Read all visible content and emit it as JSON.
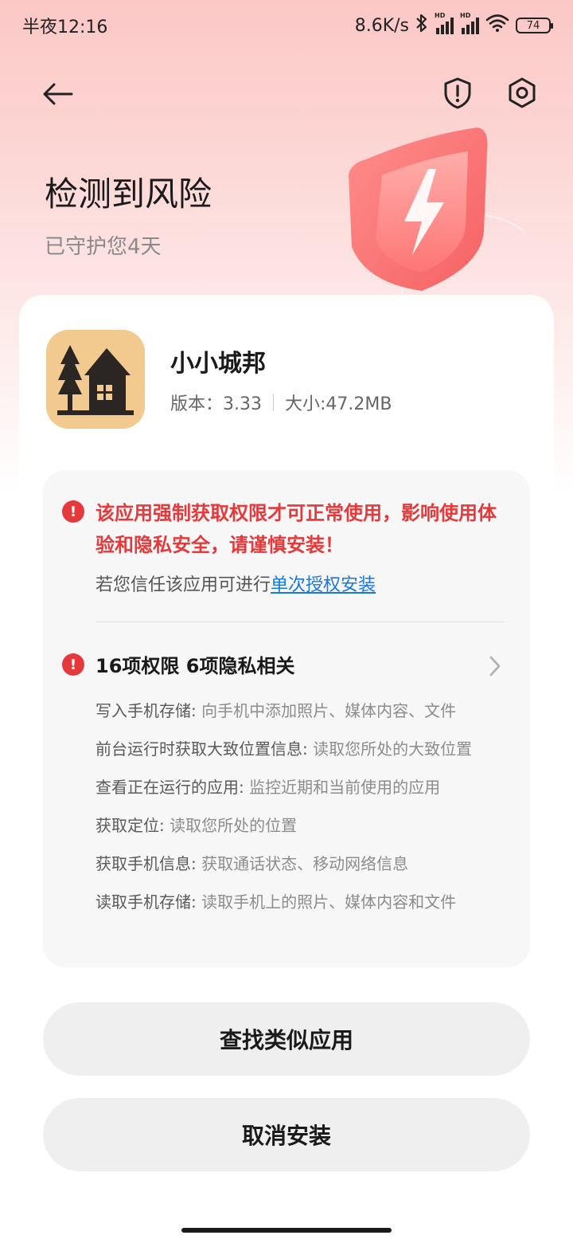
{
  "status_bar": {
    "time": "半夜12:16",
    "net_speed": "8.6K/s",
    "hd1": "HD",
    "hd2": "HD",
    "battery": "74"
  },
  "header": {
    "title": "检测到风险",
    "subtitle": "已守护您4天"
  },
  "app": {
    "name": "小小城邦",
    "version": "版本：3.33",
    "size": "大小:47.2MB"
  },
  "warning": {
    "message": "该应用强制获取权限才可正常使用，影响使用体验和隐私安全，请谨慎安装！",
    "trust_prefix": "若您信任该应用可进行",
    "trust_link": "单次授权安装"
  },
  "permissions": {
    "summary": "16项权限 6项隐私相关",
    "items": [
      {
        "name": "写入手机存储: ",
        "desc": "向手机中添加照片、媒体内容、文件"
      },
      {
        "name": "前台运行时获取大致位置信息: ",
        "desc": "读取您所处的大致位置"
      },
      {
        "name": "查看正在运行的应用: ",
        "desc": "监控近期和当前使用的应用"
      },
      {
        "name": "获取定位: ",
        "desc": "读取您所处的位置"
      },
      {
        "name": "获取手机信息: ",
        "desc": "获取通话状态、移动网络信息"
      },
      {
        "name": "读取手机存储: ",
        "desc": "读取手机上的照片、媒体内容和文件"
      }
    ]
  },
  "buttons": {
    "find_similar": "查找类似应用",
    "cancel_install": "取消安装"
  },
  "colors": {
    "danger": "#e5393b",
    "link": "#1877e8",
    "app_icon_bg": "#f2c98f"
  }
}
